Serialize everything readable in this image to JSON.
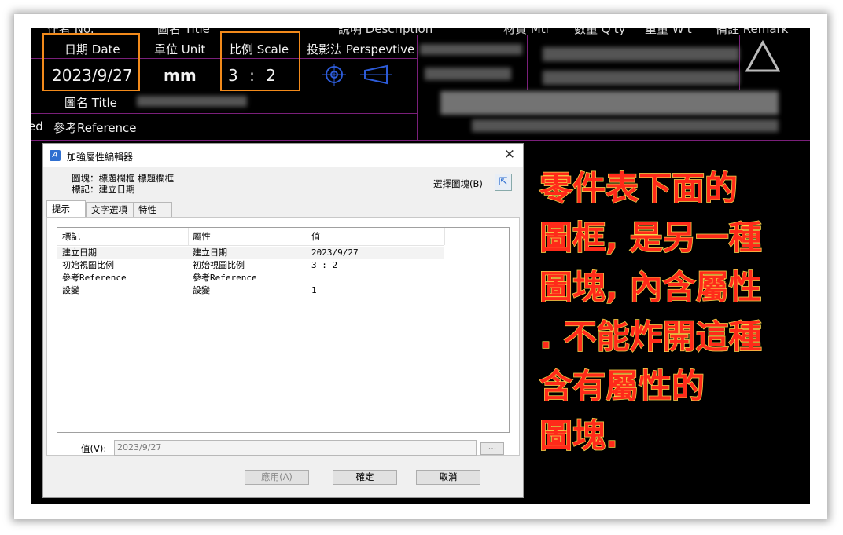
{
  "cad": {
    "top_row": [
      "作者 No.",
      "圖名 Title",
      "說明 Description",
      "材質 Mtl",
      "數量 Q'ty",
      "重量 W't",
      "備註 Remark"
    ],
    "date_label": "日期 Date",
    "date_value": "2023/9/27",
    "unit_label": "單位 Unit",
    "unit_value": "mm",
    "scale_label": "比例 Scale",
    "scale_value": "3 : 2",
    "perspective_label": "投影法 Perspevtive",
    "title_label": "圖名 Title",
    "reference_label": "參考Reference",
    "left_fragment": "ed"
  },
  "dialog": {
    "title": "加強屬性編輯器",
    "close": "✕",
    "block_line": "圖塊：標題欄框 標題欄框",
    "tag_line": "標記：建立日期",
    "select_block_label": "選擇圖塊(B)",
    "tabs": [
      "提示",
      "文字選項",
      "特性"
    ],
    "columns": [
      "標記",
      "屬性",
      "值"
    ],
    "rows": [
      {
        "tag": "建立日期",
        "prompt": "建立日期",
        "value": "2023/9/27"
      },
      {
        "tag": "初始視圖比例",
        "prompt": "初始視圖比例",
        "value": "3 : 2"
      },
      {
        "tag": "參考Reference",
        "prompt": "參考Reference",
        "value": ""
      },
      {
        "tag": "設變",
        "prompt": "設變",
        "value": "1"
      }
    ],
    "value_label": "值(V):",
    "value_field": "2023/9/27",
    "dots": "...",
    "apply": "應用(A)",
    "ok": "確定",
    "cancel": "取消"
  },
  "annotation": {
    "lines": [
      "零件表下面的",
      "圖框, 是另一種",
      "圖塊, 內含屬性",
      ". 不能炸開這種",
      "含有屬性的",
      "圖塊."
    ],
    "color": "#ff2a1a",
    "outline": "#f3d84a"
  },
  "colors": {
    "cad_bg": "#000000",
    "cad_lines": "#7a1f7a",
    "highlight": "#f28a1b"
  }
}
